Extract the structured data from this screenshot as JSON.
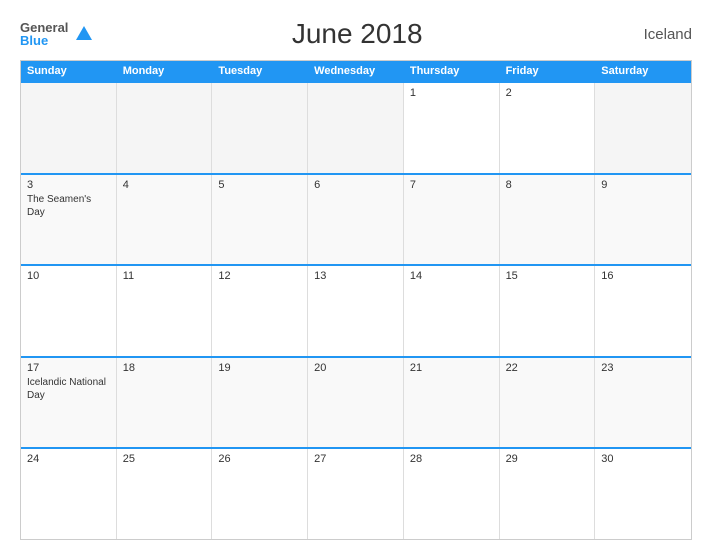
{
  "header": {
    "logo": {
      "general": "General",
      "blue": "Blue"
    },
    "title": "June 2018",
    "country": "Iceland"
  },
  "calendar": {
    "dayHeaders": [
      "Sunday",
      "Monday",
      "Tuesday",
      "Wednesday",
      "Thursday",
      "Friday",
      "Saturday"
    ],
    "weeks": [
      [
        {
          "day": "",
          "empty": true
        },
        {
          "day": "",
          "empty": true
        },
        {
          "day": "",
          "empty": true
        },
        {
          "day": "",
          "empty": true
        },
        {
          "day": "1",
          "empty": false,
          "event": ""
        },
        {
          "day": "2",
          "empty": false,
          "event": ""
        },
        {
          "day": "",
          "empty": true
        }
      ],
      [
        {
          "day": "3",
          "empty": false,
          "event": "The Seamen's Day"
        },
        {
          "day": "4",
          "empty": false,
          "event": ""
        },
        {
          "day": "5",
          "empty": false,
          "event": ""
        },
        {
          "day": "6",
          "empty": false,
          "event": ""
        },
        {
          "day": "7",
          "empty": false,
          "event": ""
        },
        {
          "day": "8",
          "empty": false,
          "event": ""
        },
        {
          "day": "9",
          "empty": false,
          "event": ""
        }
      ],
      [
        {
          "day": "10",
          "empty": false,
          "event": ""
        },
        {
          "day": "11",
          "empty": false,
          "event": ""
        },
        {
          "day": "12",
          "empty": false,
          "event": ""
        },
        {
          "day": "13",
          "empty": false,
          "event": ""
        },
        {
          "day": "14",
          "empty": false,
          "event": ""
        },
        {
          "day": "15",
          "empty": false,
          "event": ""
        },
        {
          "day": "16",
          "empty": false,
          "event": ""
        }
      ],
      [
        {
          "day": "17",
          "empty": false,
          "event": "Icelandic National Day"
        },
        {
          "day": "18",
          "empty": false,
          "event": ""
        },
        {
          "day": "19",
          "empty": false,
          "event": ""
        },
        {
          "day": "20",
          "empty": false,
          "event": ""
        },
        {
          "day": "21",
          "empty": false,
          "event": ""
        },
        {
          "day": "22",
          "empty": false,
          "event": ""
        },
        {
          "day": "23",
          "empty": false,
          "event": ""
        }
      ],
      [
        {
          "day": "24",
          "empty": false,
          "event": ""
        },
        {
          "day": "25",
          "empty": false,
          "event": ""
        },
        {
          "day": "26",
          "empty": false,
          "event": ""
        },
        {
          "day": "27",
          "empty": false,
          "event": ""
        },
        {
          "day": "28",
          "empty": false,
          "event": ""
        },
        {
          "day": "29",
          "empty": false,
          "event": ""
        },
        {
          "day": "30",
          "empty": false,
          "event": ""
        }
      ]
    ]
  }
}
